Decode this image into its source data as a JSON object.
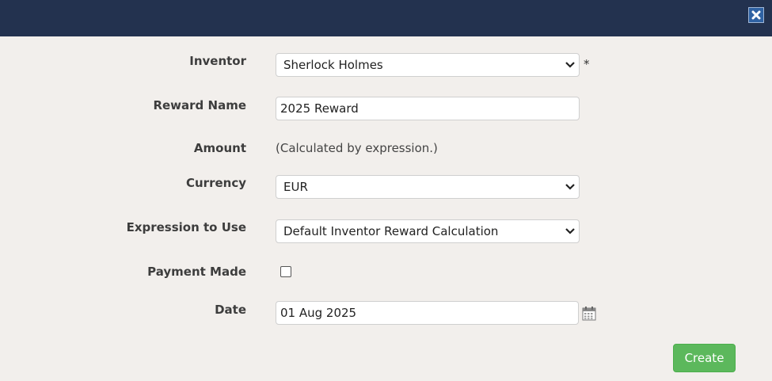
{
  "dialog": {
    "close_icon": "close-icon"
  },
  "form": {
    "inventor": {
      "label": "Inventor",
      "value": "Sherlock Holmes",
      "required_marker": "*"
    },
    "reward_name": {
      "label": "Reward Name",
      "value": "2025 Reward"
    },
    "amount": {
      "label": "Amount",
      "value": "(Calculated by expression.)"
    },
    "currency": {
      "label": "Currency",
      "value": "EUR"
    },
    "expression": {
      "label": "Expression to Use",
      "value": "Default Inventor Reward Calculation"
    },
    "payment_made": {
      "label": "Payment Made",
      "checked": false
    },
    "date": {
      "label": "Date",
      "value": "01 Aug 2025",
      "icon": "calendar-icon"
    }
  },
  "actions": {
    "create_label": "Create"
  },
  "colors": {
    "title_bar": "#23324f",
    "background": "#f2efec",
    "create_button": "#5cb85c",
    "close_button": "#2f62a3"
  }
}
